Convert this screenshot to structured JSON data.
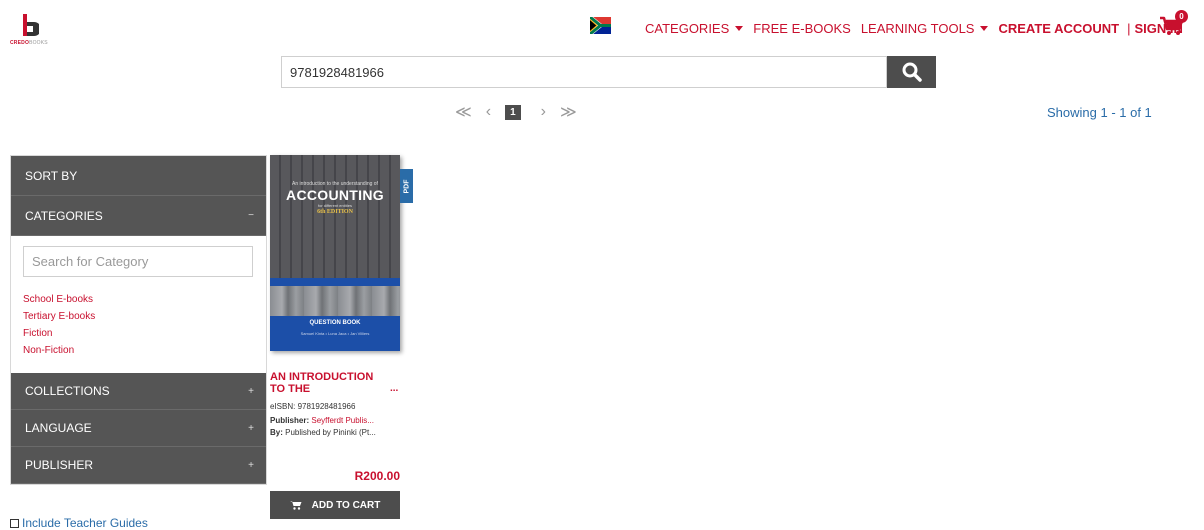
{
  "header": {
    "logo_text": "CREDOBOOKS",
    "logo_text_red": "CREDO",
    "logo_text_grey": "BOOKS",
    "nav": {
      "categories": "CATEGORIES",
      "free_ebooks": "FREE E-BOOKS",
      "learning_tools": "LEARNING TOOLS",
      "create_account": "CREATE ACCOUNT",
      "separator": "|",
      "sign_in": "SIGN IN"
    },
    "cart_count": "0"
  },
  "search": {
    "value": "9781928481966",
    "button_icon": "search-icon"
  },
  "pagination": {
    "first": "≪",
    "prev": "‹",
    "current": "1",
    "next": "›",
    "last": "≫",
    "showing": "Showing 1 - 1 of 1"
  },
  "sidebar": {
    "sort_by": "SORT BY",
    "categories": {
      "label": "CATEGORIES",
      "sign": "−"
    },
    "category_search_placeholder": "Search for Category",
    "category_items": [
      "School E-books",
      "Tertiary E-books",
      "Fiction",
      "Non-Fiction"
    ],
    "collections": {
      "label": "COLLECTIONS",
      "sign": "+"
    },
    "language": {
      "label": "LANGUAGE",
      "sign": "+"
    },
    "publisher": {
      "label": "PUBLISHER",
      "sign": "+"
    },
    "include_teacher_guides": "Include Teacher Guides"
  },
  "product": {
    "format_tag": "PDF",
    "cover": {
      "small_top": "An introduction to the understanding of",
      "title": "ACCOUNTING",
      "subtitle": "for different entities",
      "edition": "6th EDITION",
      "book_type": "QUESTION BOOK",
      "authors": "Samuel Kinta  •  Luna Jaca  •  Jan Villiers"
    },
    "title_line1": "AN INTRODUCTION",
    "title_line2": "TO THE",
    "title_more": "...",
    "eisbn_label": "eISBN:",
    "eisbn_value": "9781928481966",
    "publisher_label": "Publisher:",
    "publisher_value": "Seyfferdt Publis...",
    "by_label": "By:",
    "by_value": "Published by Pininki (Pt...",
    "price": "R200.00",
    "add_to_cart": "ADD TO CART"
  },
  "colors": {
    "brand_red": "#c8102e",
    "dark_grey": "#4d4d4d",
    "link_blue": "#2a6ca8"
  }
}
